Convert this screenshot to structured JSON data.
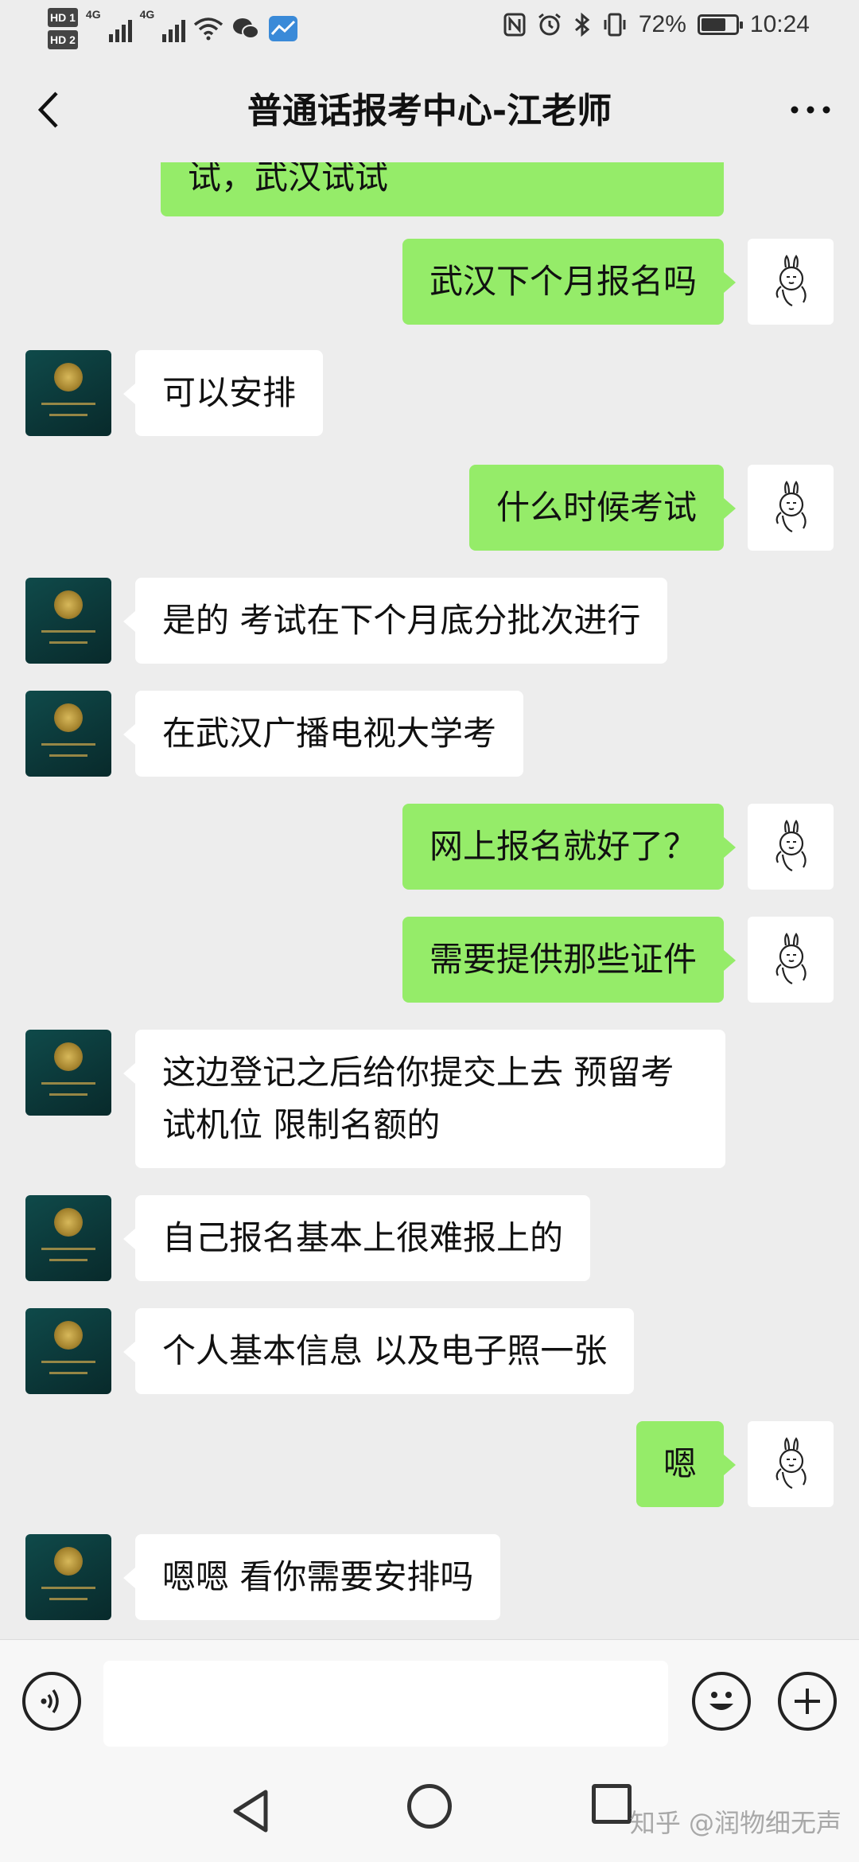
{
  "status_bar": {
    "hd1": "HD 1",
    "hd2": "HD 2",
    "net1": "4G",
    "net2": "4G",
    "battery_text": "72%",
    "battery_level": 0.72,
    "time": "10:24",
    "icons": [
      "nfc-icon",
      "alarm-icon",
      "bluetooth-icon",
      "vibrate-icon",
      "wifi-icon",
      "wechat-icon",
      "app-icon"
    ]
  },
  "header": {
    "title": "普通话报考中心-江老师"
  },
  "messages": [
    {
      "from": "me",
      "text": "试，武汉试试",
      "partial": true
    },
    {
      "from": "me",
      "text": "武汉下个月报名吗"
    },
    {
      "from": "them",
      "text": "可以安排"
    },
    {
      "from": "me",
      "text": "什么时候考试"
    },
    {
      "from": "them",
      "text": "是的 考试在下个月底分批次进行"
    },
    {
      "from": "them",
      "text": "在武汉广播电视大学考"
    },
    {
      "from": "me",
      "text": "网上报名就好了？"
    },
    {
      "from": "me",
      "text": "需要提供那些证件"
    },
    {
      "from": "them",
      "lines": [
        "这边登记之后给你提交上去 预留考",
        "试机位 限制名额的"
      ]
    },
    {
      "from": "them",
      "text": "自己报名基本上很难报上的"
    },
    {
      "from": "them",
      "text": "个人基本信息 以及电子照一张"
    },
    {
      "from": "me",
      "text": "嗯"
    },
    {
      "from": "them",
      "text": "嗯嗯 看你需要安排吗"
    }
  ],
  "input_bar": {
    "value": "",
    "icons": [
      "voice-icon",
      "emoji-icon",
      "plus-icon"
    ]
  },
  "nav_bar": {
    "icons": [
      "nav-back-icon",
      "nav-home-icon",
      "nav-recent-icon"
    ],
    "watermark": "知乎 @润物细无声"
  },
  "colors": {
    "background": "#ededed",
    "my_bubble": "#95ec69",
    "their_bubble": "#ffffff"
  }
}
